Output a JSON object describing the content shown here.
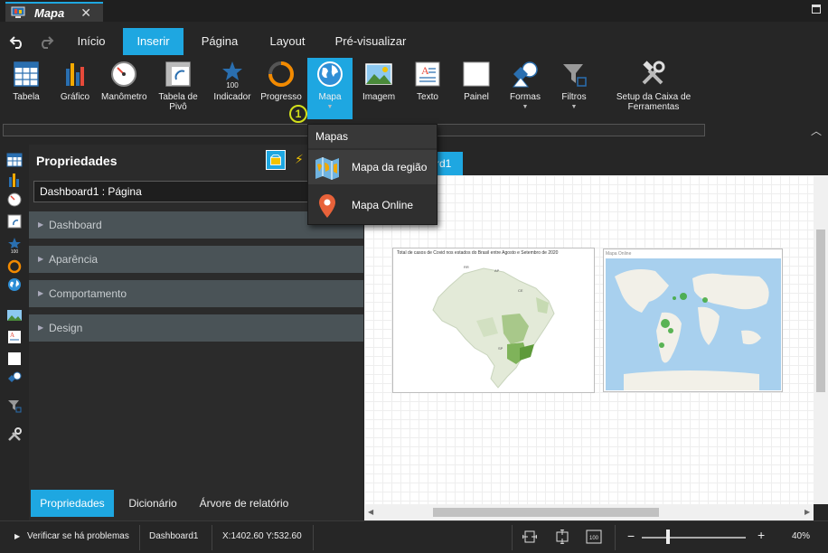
{
  "window": {
    "title": "Mapa",
    "close": "✕"
  },
  "menu": {
    "tabs": [
      {
        "label": "Início"
      },
      {
        "label": "Inserir"
      },
      {
        "label": "Página"
      },
      {
        "label": "Layout"
      },
      {
        "label": "Pré-visualizar"
      }
    ]
  },
  "ribbon": {
    "items": [
      {
        "label": "Tabela"
      },
      {
        "label": "Gráfico"
      },
      {
        "label": "Manômetro"
      },
      {
        "label": "Tabela de Pivô"
      },
      {
        "label": "Indicador"
      },
      {
        "label": "Progresso"
      },
      {
        "label": "Mapa"
      },
      {
        "label": "Imagem"
      },
      {
        "label": "Texto"
      },
      {
        "label": "Painel"
      },
      {
        "label": "Formas"
      },
      {
        "label": "Filtros"
      },
      {
        "label": "Setup da Caixa de Ferramentas"
      }
    ],
    "indicator_value": "100",
    "step_marker": "1"
  },
  "dropdown": {
    "header": "Mapas",
    "items": [
      {
        "label": "Mapa da região"
      },
      {
        "label": "Mapa Online"
      }
    ]
  },
  "properties": {
    "title": "Propriedades",
    "selected": "Dashboard1 : Página",
    "sections": [
      {
        "label": "Dashboard"
      },
      {
        "label": "Aparência"
      },
      {
        "label": "Comportamento"
      },
      {
        "label": "Design"
      }
    ],
    "bottom_tabs": [
      {
        "label": "Propriedades"
      },
      {
        "label": "Dicionário"
      },
      {
        "label": "Árvore de relatório"
      }
    ]
  },
  "canvas": {
    "tab_label": "rd1",
    "map_region_title": "Total de casos de Covid nos estados do Brasil entre Agosto e Setembro de 2020",
    "map_online_title": "Mapa Online"
  },
  "status": {
    "check": "Verificar se há problemas",
    "page": "Dashboard1",
    "coords": "X:1402.60 Y:532.60",
    "zoom": "40%",
    "zoom_minus": "−",
    "zoom_plus": "+"
  },
  "colors": {
    "accent": "#1ea7e1",
    "background": "#262626",
    "section": "#4a5357",
    "marker": "#d2e01b"
  }
}
